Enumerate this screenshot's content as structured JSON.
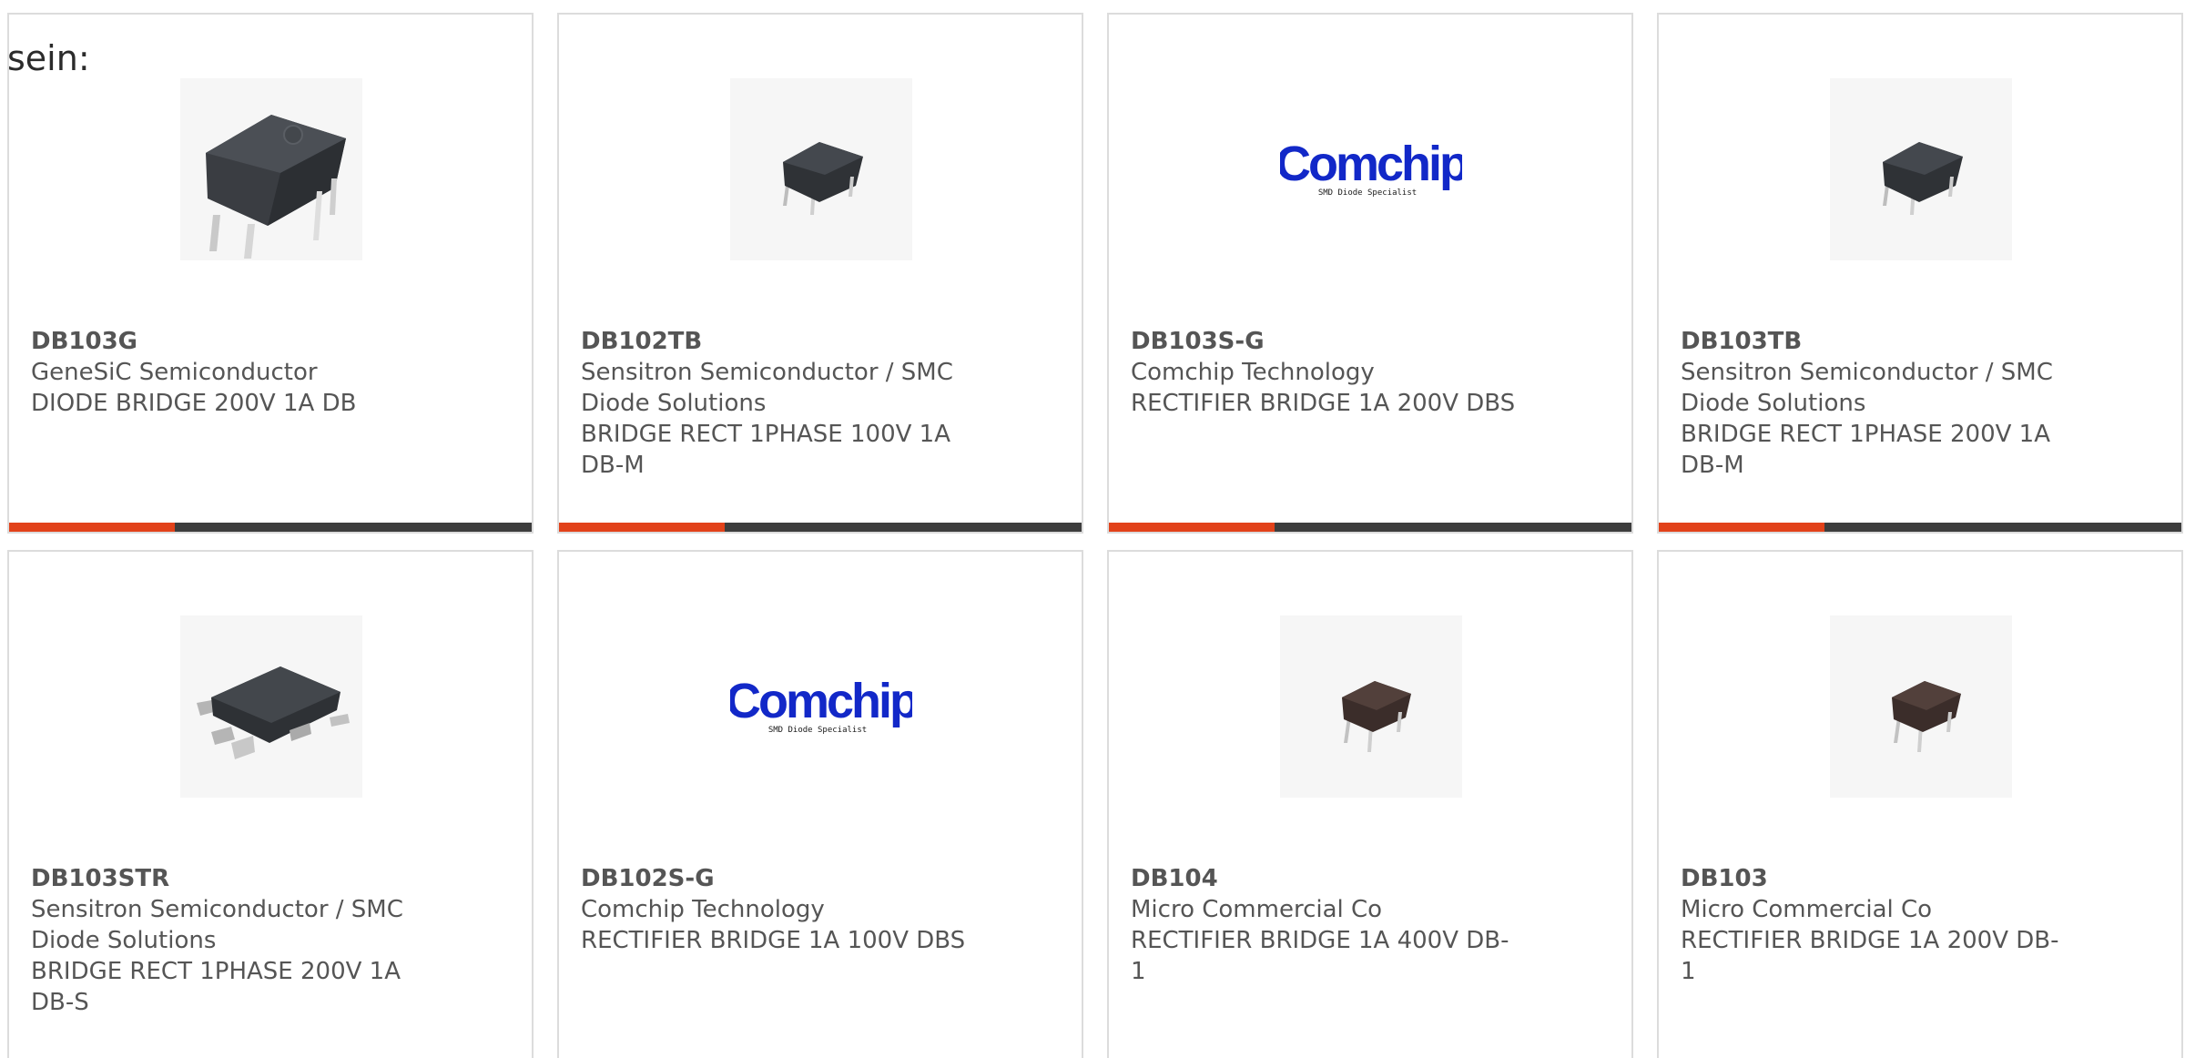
{
  "intro_text": "sein:",
  "colors": {
    "accent": "#e2421a",
    "bar_dark": "#3d3d3d",
    "card_border": "#dcdcdc",
    "text": "#555555",
    "comchip_blue": "#1228c8"
  },
  "products": [
    {
      "part": "DB103G",
      "manufacturer": "GeneSiC Semiconductor",
      "desc1": "DIODE BRIDGE 200V 1A DB",
      "desc2": "",
      "image": "dip-bridge-chip-large"
    },
    {
      "part": "DB102TB",
      "manufacturer": "Sensitron Semiconductor / SMC",
      "manufacturer2": "Diode Solutions",
      "desc1": "BRIDGE RECT 1PHASE 100V 1A",
      "desc2": "DB-M",
      "image": "dip-bridge-chip-small"
    },
    {
      "part": "DB103S-G",
      "manufacturer": "Comchip Technology",
      "desc1": "RECTIFIER BRIDGE 1A 200V DBS",
      "desc2": "",
      "image": "comchip-logo",
      "logo_text": "Comchip",
      "logo_tagline": "SMD Diode Specialist"
    },
    {
      "part": "DB103TB",
      "manufacturer": "Sensitron Semiconductor / SMC",
      "manufacturer2": "Diode Solutions",
      "desc1": "BRIDGE RECT 1PHASE 200V 1A",
      "desc2": "DB-M",
      "image": "dip-bridge-chip-small"
    },
    {
      "part": "DB103STR",
      "manufacturer": "Sensitron Semiconductor / SMC",
      "manufacturer2": "Diode Solutions",
      "desc1": "BRIDGE RECT 1PHASE 200V 1A",
      "desc2": "DB-S",
      "image": "smd-bridge-chip"
    },
    {
      "part": "DB102S-G",
      "manufacturer": "Comchip Technology",
      "desc1": "RECTIFIER BRIDGE 1A 100V DBS",
      "desc2": "",
      "image": "comchip-logo",
      "logo_text": "Comchip",
      "logo_tagline": "SMD Diode Specialist"
    },
    {
      "part": "DB104",
      "manufacturer": "Micro Commercial Co",
      "desc1": "RECTIFIER BRIDGE 1A 400V DB-1",
      "desc2": "",
      "image": "dip-bridge-chip-brown"
    },
    {
      "part": "DB103",
      "manufacturer": "Micro Commercial Co",
      "desc1": "RECTIFIER BRIDGE 1A 200V DB-1",
      "desc2": "",
      "image": "dip-bridge-chip-brown"
    }
  ]
}
